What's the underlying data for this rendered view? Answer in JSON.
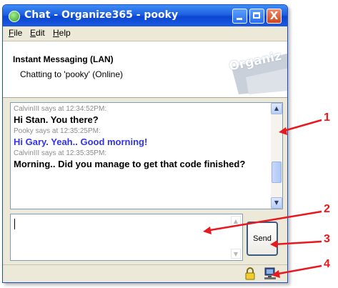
{
  "window": {
    "title": "Chat - Organize365 - pooky",
    "close_glyph": "X"
  },
  "menu": {
    "items": [
      "File",
      "Edit",
      "Help"
    ]
  },
  "header": {
    "title": "Instant Messaging (LAN)",
    "status": "Chatting to 'pooky' (Online)",
    "logo_text": "Organiz"
  },
  "chat": {
    "messages": [
      {
        "meta": "CalvinIII says at 12:34:52PM:",
        "text": "Hi Stan.  You there?",
        "style": "black"
      },
      {
        "meta": "Pooky says at 12:35:25PM:",
        "text": "Hi Gary.  Yeah..  Good morning!",
        "style": "blue"
      },
      {
        "meta": "CalvinIII says at 12:35:35PM:",
        "text": "Morning..  Did you manage to get that code finished?",
        "style": "black"
      }
    ],
    "scroll_position": 0.6
  },
  "input": {
    "value": ""
  },
  "send_button": {
    "label": "Send"
  },
  "status_icons": [
    "lock-icon",
    "network-computer-icon"
  ],
  "callouts": [
    "1",
    "2",
    "3",
    "4"
  ],
  "colors": {
    "titlebar": "#0a46d2",
    "window_face": "#ece9d8",
    "message_blue": "#3333ee",
    "meta_gray": "#8c8c8c",
    "callout_red": "#e8191e"
  }
}
